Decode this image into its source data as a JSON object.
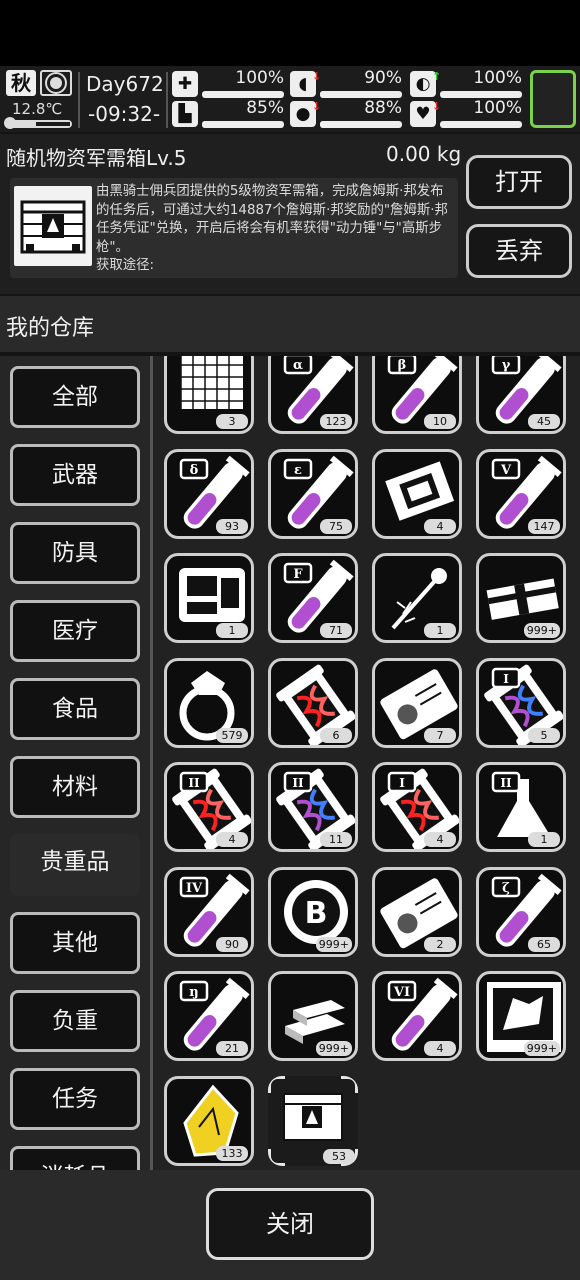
{
  "status": {
    "season": "秋",
    "weather_icon": "sun-icon",
    "temperature": "12.8℃",
    "day": "Day672",
    "time": "-09:32-",
    "stats": [
      {
        "icon": "medkit-icon",
        "glyph": "✚",
        "value": "100%",
        "level": 1.0,
        "trend": "",
        "trend_color": ""
      },
      {
        "icon": "stomach-icon",
        "glyph": "◖",
        "value": "90%",
        "level": 0.9,
        "trend": "↓",
        "trend_color": "#e03030"
      },
      {
        "icon": "pill-icon",
        "glyph": "◐",
        "value": "100%",
        "level": 1.0,
        "trend": "↑",
        "trend_color": "#3cc33c"
      },
      {
        "icon": "boot-icon",
        "glyph": "▙",
        "value": "85%",
        "level": 0.85,
        "trend": "",
        "trend_color": ""
      },
      {
        "icon": "water-drop-icon",
        "glyph": "●",
        "value": "88%",
        "level": 0.88,
        "trend": "↓",
        "trend_color": "#e03030"
      },
      {
        "icon": "heart-icon",
        "glyph": "♥",
        "value": "100%",
        "level": 1.0,
        "trend": "↓",
        "trend_color": "#e03030"
      }
    ]
  },
  "item": {
    "name": "随机物资军需箱Lv.5",
    "weight": "0.00 kg",
    "description": "由黑骑士佣兵团提供的5级物资军需箱，完成詹姆斯·邦发布的任务后，可通过大约14887个詹姆斯·邦奖励的\"詹姆斯·邦任务凭证\"兑换，开启后将会有机率获得\"动力锤\"与\"高斯步枪\"。",
    "source_label": "获取途径:",
    "open_label": "打开",
    "discard_label": "丢弃"
  },
  "warehouse": {
    "title": "我的仓库",
    "categories": [
      "全部",
      "武器",
      "防具",
      "医疗",
      "食品",
      "材料",
      "贵重品",
      "其他",
      "负重",
      "任务",
      "消耗品"
    ],
    "active_category": "贵重品",
    "items": [
      {
        "name": "blueprint-icon",
        "count": "3"
      },
      {
        "name": "tube-alpha-icon",
        "label": "α",
        "count": "123"
      },
      {
        "name": "tube-beta-icon",
        "label": "β",
        "count": "10"
      },
      {
        "name": "tube-gamma-icon",
        "label": "γ",
        "count": "45"
      },
      {
        "name": "tube-delta-icon",
        "label": "δ",
        "count": "93"
      },
      {
        "name": "tube-epsilon-icon",
        "label": "ε",
        "count": "75"
      },
      {
        "name": "cpu-chip-icon",
        "count": "4"
      },
      {
        "name": "tube-v-icon",
        "label": "V",
        "count": "147"
      },
      {
        "name": "circuit-board-icon",
        "count": "1"
      },
      {
        "name": "tube-f-icon",
        "label": "F",
        "count": "71"
      },
      {
        "name": "injector-icon",
        "count": "1"
      },
      {
        "name": "cash-bundle-icon",
        "count": "999+"
      },
      {
        "name": "diamond-ring-icon",
        "count": "579"
      },
      {
        "name": "capsule-red-icon",
        "count": "6"
      },
      {
        "name": "id-card-icon",
        "count": "7"
      },
      {
        "name": "capsule-dna-i-icon",
        "label": "I",
        "count": "5"
      },
      {
        "name": "capsule-red-ii-icon",
        "label": "II",
        "count": "4"
      },
      {
        "name": "capsule-dna-ii-icon",
        "label": "II",
        "count": "11"
      },
      {
        "name": "capsule-red-i-icon",
        "label": "I",
        "count": "4"
      },
      {
        "name": "flask-ii-icon",
        "label": "II",
        "count": "1"
      },
      {
        "name": "tube-iv-icon",
        "label": "IV",
        "count": "90"
      },
      {
        "name": "bitcoin-icon",
        "label": "B",
        "count": "999+"
      },
      {
        "name": "id-card-icon",
        "count": "2"
      },
      {
        "name": "tube-zeta-icon",
        "label": "ζ",
        "count": "65"
      },
      {
        "name": "tube-eta-icon",
        "label": "ŋ",
        "count": "21"
      },
      {
        "name": "gold-bars-icon",
        "count": "999+"
      },
      {
        "name": "tube-vi-icon",
        "label": "VI",
        "count": "4"
      },
      {
        "name": "map-poster-icon",
        "count": "999+"
      },
      {
        "name": "gold-ore-icon",
        "count": "133"
      },
      {
        "name": "supply-crate-icon",
        "count": "53",
        "selected": true
      }
    ]
  },
  "close_label": "关闭",
  "colors": {
    "accent_green": "#7ad14a",
    "liquid_purple": "#b04fd0",
    "gold": "#f0d020"
  }
}
